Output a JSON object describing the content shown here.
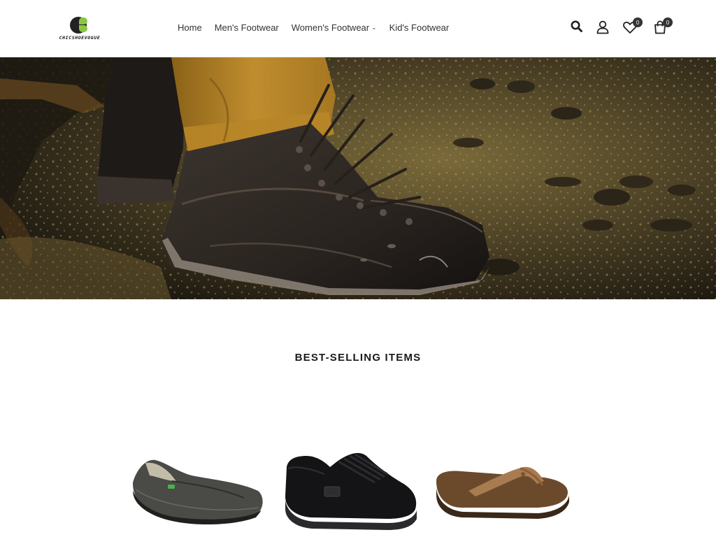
{
  "header": {
    "logo_text": "CHICSHOEVOGUE",
    "nav": [
      {
        "label": "Home",
        "has_dropdown": false
      },
      {
        "label": "Men's Footwear",
        "has_dropdown": false
      },
      {
        "label": "Women's Footwear",
        "has_dropdown": true
      },
      {
        "label": "Kid's Footwear",
        "has_dropdown": false
      }
    ],
    "icons": {
      "search": "search-icon",
      "account": "user-icon",
      "wishlist": "heart-icon",
      "cart": "shopping-bag-icon"
    },
    "wishlist_count": "0",
    "cart_count": "0"
  },
  "hero": {
    "image": "hiking-boot-on-wet-gravel"
  },
  "best_selling": {
    "title": "BEST-SELLING ITEMS",
    "items": [
      {
        "image": "grey-slip-on-shoe"
      },
      {
        "image": "black-skate-sneaker"
      },
      {
        "image": "brown-flip-flop-sandal"
      }
    ]
  },
  "colors": {
    "accent": "#8cc63f",
    "text": "#333333",
    "badge": "#333333"
  }
}
